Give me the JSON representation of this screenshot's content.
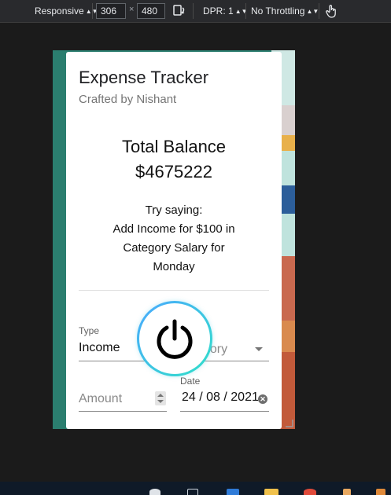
{
  "devtools": {
    "device": "Responsive",
    "width": "306",
    "times": "×",
    "height": "480",
    "dpr": "DPR: 1",
    "throttling": "No Throttling"
  },
  "app": {
    "title": "Expense Tracker",
    "subtitle": "Crafted by Nishant",
    "balance_label": "Total Balance",
    "balance_value": "$4675222",
    "try_saying": [
      "Try saying:",
      "Add Income for $100 in",
      "Category Salary for",
      "Monday"
    ],
    "type_label": "Type",
    "type_value": "Income",
    "category_placeholder": "gory",
    "amount_placeholder": "Amount",
    "date_label": "Date",
    "date_value": "24 / 08 / 2021"
  },
  "icons": {
    "mic_button": "power-icon",
    "clear": "clear-icon"
  },
  "colors": {
    "frame_bg": "#2b7e6f",
    "mic_ring_start": "#4aa8ff",
    "mic_ring_end": "#30e0c8"
  }
}
